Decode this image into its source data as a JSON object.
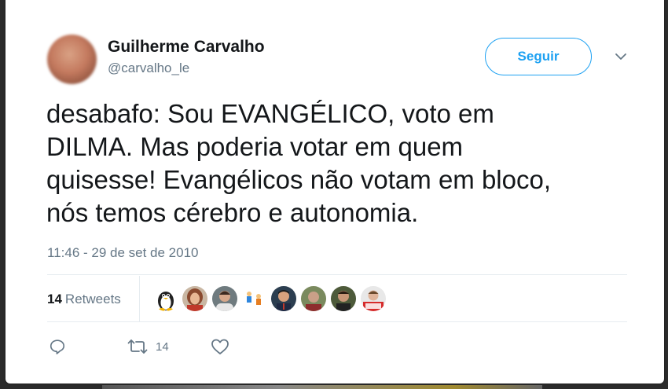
{
  "user": {
    "name": "Guilherme Carvalho",
    "handle": "@carvalho_le"
  },
  "follow_button": {
    "label": "Seguir"
  },
  "tweet": {
    "lines": [
      "desabafo: Sou EVANGÉLICO, voto em",
      "DILMA. Mas poderia votar em quem",
      "quisesse! Evangélicos não votam em bloco,",
      "nós temos cérebro e autonomia."
    ],
    "timestamp": "11:46 - 29 de set de 2010"
  },
  "stats": {
    "retweets_count": "14",
    "retweets_label": "Retweets"
  },
  "retweeter_avatars": [
    "penguin",
    "woman",
    "person",
    "small-figures",
    "man-1",
    "man-2",
    "man-3",
    "dilma-badge"
  ],
  "actions": {
    "retweet_count": "14"
  },
  "colors": {
    "accent": "#1da1f2",
    "text": "#14171a",
    "muted": "#657786"
  },
  "icons": [
    "chevron-down-icon",
    "reply-icon",
    "retweet-icon",
    "like-icon"
  ]
}
